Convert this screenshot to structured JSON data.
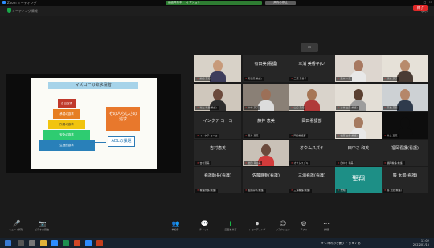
{
  "window": {
    "title": "Zoom ミーティング",
    "minimize": "—",
    "maximize": "□",
    "close": "✕"
  },
  "banner": {
    "status": "画面共有中",
    "share_label": "オプション",
    "stop_label": "共有の停止"
  },
  "meeting_bar": {
    "info": "ミーティング情報",
    "view": "表示"
  },
  "slide": {
    "title": "マズローの欲求段階",
    "pyramid": [
      "自己実現",
      "承認の欲求",
      "所属の欲求",
      "安全の欲求",
      "生理的欲求"
    ],
    "callout_main": "その人らしさの\n追求",
    "callout_sub": "ADLの課題"
  },
  "gallery_toggle": "▭",
  "participants": [
    {
      "name": "",
      "label": "前田 美和"
    },
    {
      "name": "有田美(看護)",
      "label": "有田美(看護)"
    },
    {
      "name": "三浦 美香子(い",
      "label": "三浦 美香子"
    },
    {
      "name": "",
      "label": "森本 一美"
    },
    {
      "name": "",
      "label": "清水 京子"
    },
    {
      "name": "",
      "label": "村上 千里(看護)"
    },
    {
      "name": "",
      "label": "中村 京子"
    },
    {
      "name": "",
      "label": "山口 美紀"
    },
    {
      "name": "",
      "label": "小林 由美(看護)"
    },
    {
      "name": "",
      "label": "高橋 美保"
    },
    {
      "name": "インクテ コーコ",
      "label": "インクテ コーコ"
    },
    {
      "name": "藤井 恵美",
      "label": "藤井 恵美"
    },
    {
      "name": "岡田看護部",
      "label": "岡田看護部"
    },
    {
      "name": "",
      "label": "佐藤 由香(看護)"
    },
    {
      "name": "",
      "label": "井上 直美"
    },
    {
      "name": "吉村恵美",
      "label": "吉村恵美"
    },
    {
      "name": "",
      "label": "岩田 真由美"
    },
    {
      "name": "オウムスズキ",
      "label": "オウムスズキ"
    },
    {
      "name": "田中さ 和美",
      "label": "田中さ 和美"
    },
    {
      "name": "福岡看護(看護)",
      "label": "福岡看護(看護)"
    },
    {
      "name": "看護師長(看護)",
      "label": "看護師長(看護)"
    },
    {
      "name": "佐藤麻帆(看護)",
      "label": "佐藤麻帆(看護)"
    },
    {
      "name": "三浦看護(看護)",
      "label": "三浦看護(看護)"
    },
    {
      "name": "聖翔",
      "label": "聖翔"
    },
    {
      "name": "藤 太郎(看護)",
      "label": "藤 太郎(看護)"
    }
  ],
  "toolbar": [
    {
      "icon": "🎤",
      "label": "ミュート解除"
    },
    {
      "icon": "📷",
      "label": "ビデオの開始"
    },
    {
      "icon": "👥",
      "label": "参加者"
    },
    {
      "icon": "💬",
      "label": "チャット"
    },
    {
      "icon": "⬆",
      "label": "画面を共有"
    },
    {
      "icon": "⏺",
      "label": "レコーディング"
    },
    {
      "icon": "☺",
      "label": "リアクション"
    },
    {
      "icon": "⚙",
      "label": "アプリ"
    },
    {
      "icon": "⋯",
      "label": "詳細"
    }
  ],
  "end_label": "終了",
  "taskbar": {
    "tray": "9°C 晴れのち曇り  ^  ◻  ⊕  ♪  あ",
    "time": "11:02",
    "date": "2022/01/15"
  },
  "colors": {
    "zoom_blue": "#2d8cff",
    "share_green": "#2e7d32",
    "end_red": "#e02828",
    "slide_orange": "#e8782c",
    "slide_blue": "#2c7bb6"
  }
}
